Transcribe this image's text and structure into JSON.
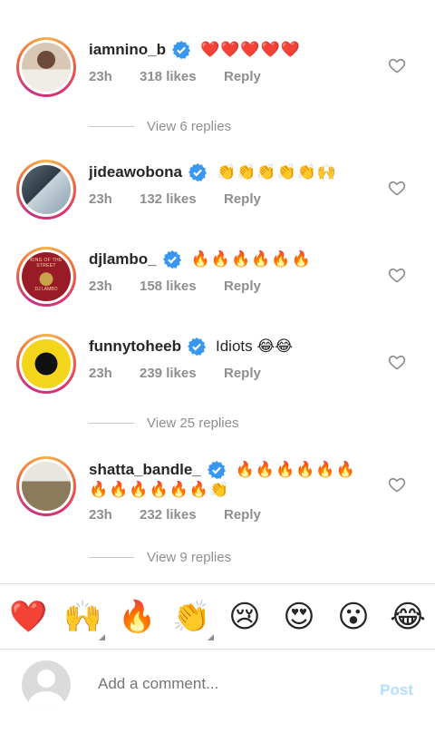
{
  "comments": [
    {
      "username": "iamnino_b",
      "text": "❤️❤️❤️❤️❤️",
      "time": "23h",
      "likes": "318 likes",
      "reply": "Reply"
    },
    {
      "username": "jideawobona",
      "text": "👏👏👏👏👏🙌",
      "time": "23h",
      "likes": "132 likes",
      "reply": "Reply"
    },
    {
      "username": "djlambo_",
      "text": "🔥🔥🔥🔥🔥🔥",
      "time": "23h",
      "likes": "158 likes",
      "reply": "Reply",
      "avatar_text_top": "KING OF THE STREET",
      "avatar_text_bottom": "DJ LAMBO"
    },
    {
      "username": "funnytoheeb",
      "text": "Idiots 😂😂",
      "time": "23h",
      "likes": "239 likes",
      "reply": "Reply"
    },
    {
      "username": "shatta_bandle_",
      "text": "🔥🔥🔥🔥🔥🔥",
      "text2": "🔥🔥🔥🔥🔥🔥👏",
      "time": "23h",
      "likes": "232 likes",
      "reply": "Reply"
    }
  ],
  "view_replies": [
    "View 6 replies",
    "View 25 replies",
    "View 9 replies"
  ],
  "emoji_bar": [
    "❤️",
    "🙌",
    "🔥",
    "👏",
    "😢",
    "😍",
    "😮",
    "😂"
  ],
  "composer": {
    "placeholder": "Add a comment...",
    "post_label": "Post"
  },
  "colors": {
    "verified": "#3897f0",
    "meta": "#8e8e8e",
    "post_disabled": "#b2dffc"
  },
  "icons": {
    "verified": "verified-badge-icon",
    "like": "heart-outline-icon"
  }
}
